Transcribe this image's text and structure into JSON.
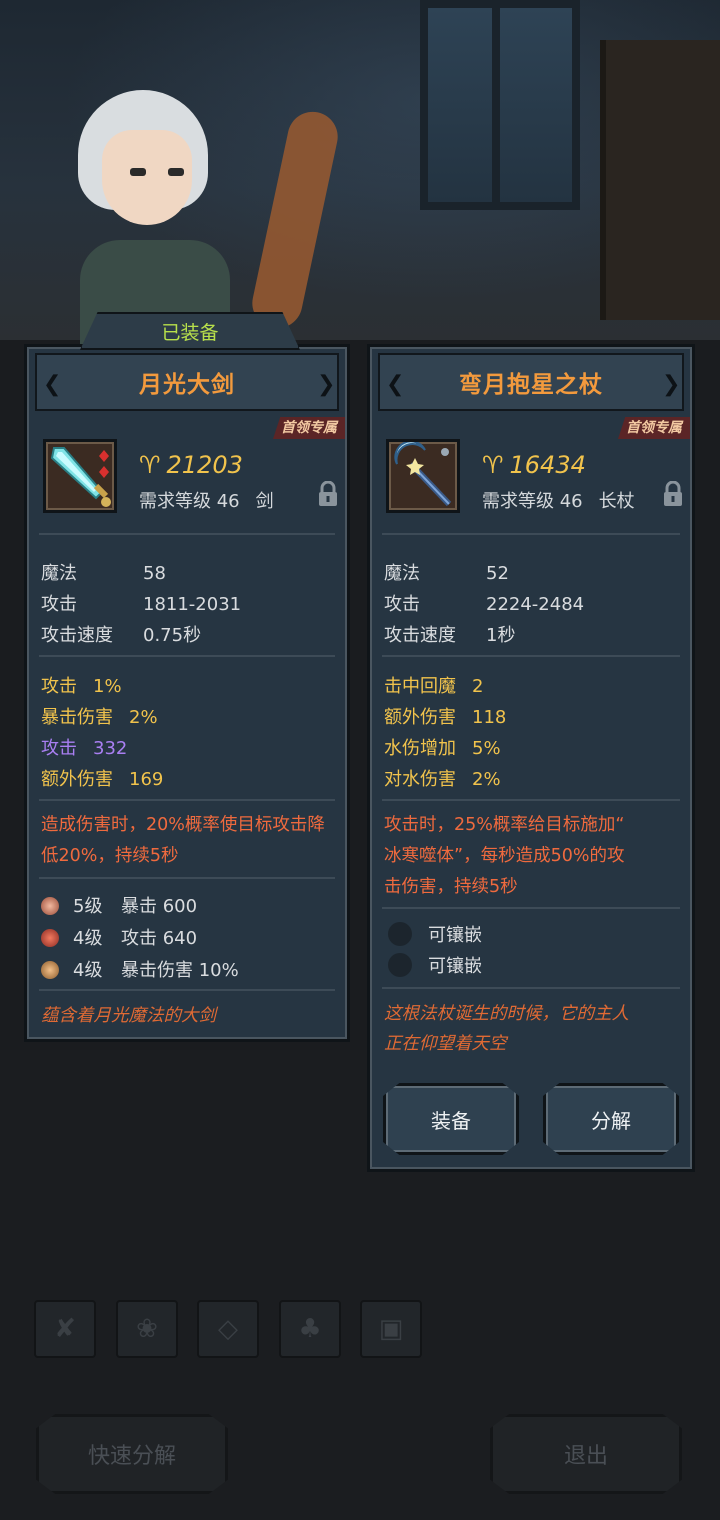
{
  "equipped_tab": "已装备",
  "left": {
    "name": "月光大剑",
    "badge": "首领专属",
    "price": "21203",
    "req_level": "需求等级 46",
    "weapon_type": "剑",
    "stats": [
      {
        "label": "魔法",
        "value": "58"
      },
      {
        "label": "攻击",
        "value": "1811-2031"
      },
      {
        "label": "攻击速度",
        "value": "0.75秒"
      }
    ],
    "bonuses": [
      {
        "label": "攻击",
        "value": "1%"
      },
      {
        "label": "暴击伤害",
        "value": "2%"
      },
      {
        "label": "攻击",
        "value": "332"
      },
      {
        "label": "额外伤害",
        "value": "169"
      }
    ],
    "effect": "造成伤害时，20%概率使目标攻击降低20%，持续5秒",
    "gems": [
      {
        "level": "5级",
        "text": "暴击 600"
      },
      {
        "level": "4级",
        "text": "攻击 640"
      },
      {
        "level": "4级",
        "text": "暴击伤害 10%"
      }
    ],
    "flavor": "蕴含着月光魔法的大剑"
  },
  "right": {
    "name": "弯月抱星之杖",
    "badge": "首领专属",
    "price": "16434",
    "req_level": "需求等级 46",
    "weapon_type": "长杖",
    "stats": [
      {
        "label": "魔法",
        "value": "52"
      },
      {
        "label": "攻击",
        "value": "2224-2484"
      },
      {
        "label": "攻击速度",
        "value": "1秒"
      }
    ],
    "bonuses": [
      {
        "label": "击中回魔",
        "value": "2"
      },
      {
        "label": "额外伤害",
        "value": "118"
      },
      {
        "label": "水伤增加",
        "value": "5%"
      },
      {
        "label": "对水伤害",
        "value": "2%"
      }
    ],
    "effect_line1": "攻击时，25%概率给目标施加“",
    "effect_line2": "冰寒噬体”，每秒造成50%的攻",
    "effect_line3": "击伤害，持续5秒",
    "sockets": [
      "可镶嵌",
      "可镶嵌"
    ],
    "flavor_line1": "这根法杖诞生的时候，它的主人",
    "flavor_line2": "正在仰望着天空",
    "equip_button": "装备",
    "disassemble_button": "分解"
  },
  "bottom": {
    "quick_disassemble": "快速分解",
    "exit": "退出"
  },
  "colors": {
    "title_orange": "#f39a3d",
    "gold": "#f1c34c",
    "purple": "#a97ff2",
    "effect_red": "#ef6a3e",
    "equipped_green": "#b8e04b"
  }
}
